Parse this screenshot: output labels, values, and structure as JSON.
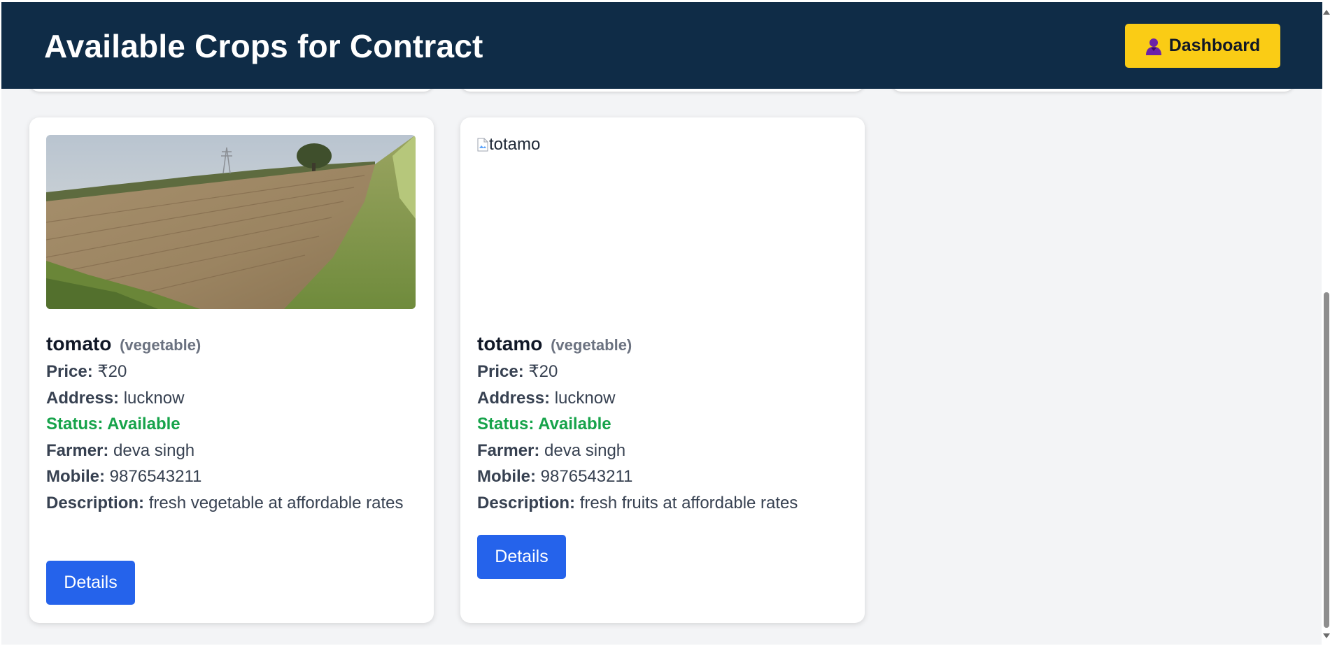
{
  "header": {
    "title": "Available Crops for Contract",
    "dashboard_label": "Dashboard",
    "dashboard_icon": "user-icon"
  },
  "labels": {
    "price": "Price:",
    "address": "Address:",
    "status": "Status:",
    "farmer": "Farmer:",
    "mobile": "Mobile:",
    "description": "Description:"
  },
  "crops": [
    {
      "name": "tomato",
      "type": "(vegetable)",
      "price": "₹20",
      "address": "lucknow",
      "status": "Available",
      "farmer": "deva singh",
      "mobile": "9876543211",
      "description": "fresh vegetable at affordable rates",
      "details_label": "Details",
      "image": "field photo"
    },
    {
      "name": "totamo",
      "type": "(vegetable)",
      "price": "₹20",
      "address": "lucknow",
      "status": "Available",
      "farmer": "deva singh",
      "mobile": "9876543211",
      "description": "fresh fruits at affordable rates",
      "details_label": "Details",
      "image_alt": "totamo"
    }
  ],
  "colors": {
    "header_bg": "#0f2c47",
    "dashboard_btn": "#facc15",
    "details_btn": "#2563eb",
    "status_available": "#16a34a",
    "page_bg": "#f3f4f6"
  }
}
